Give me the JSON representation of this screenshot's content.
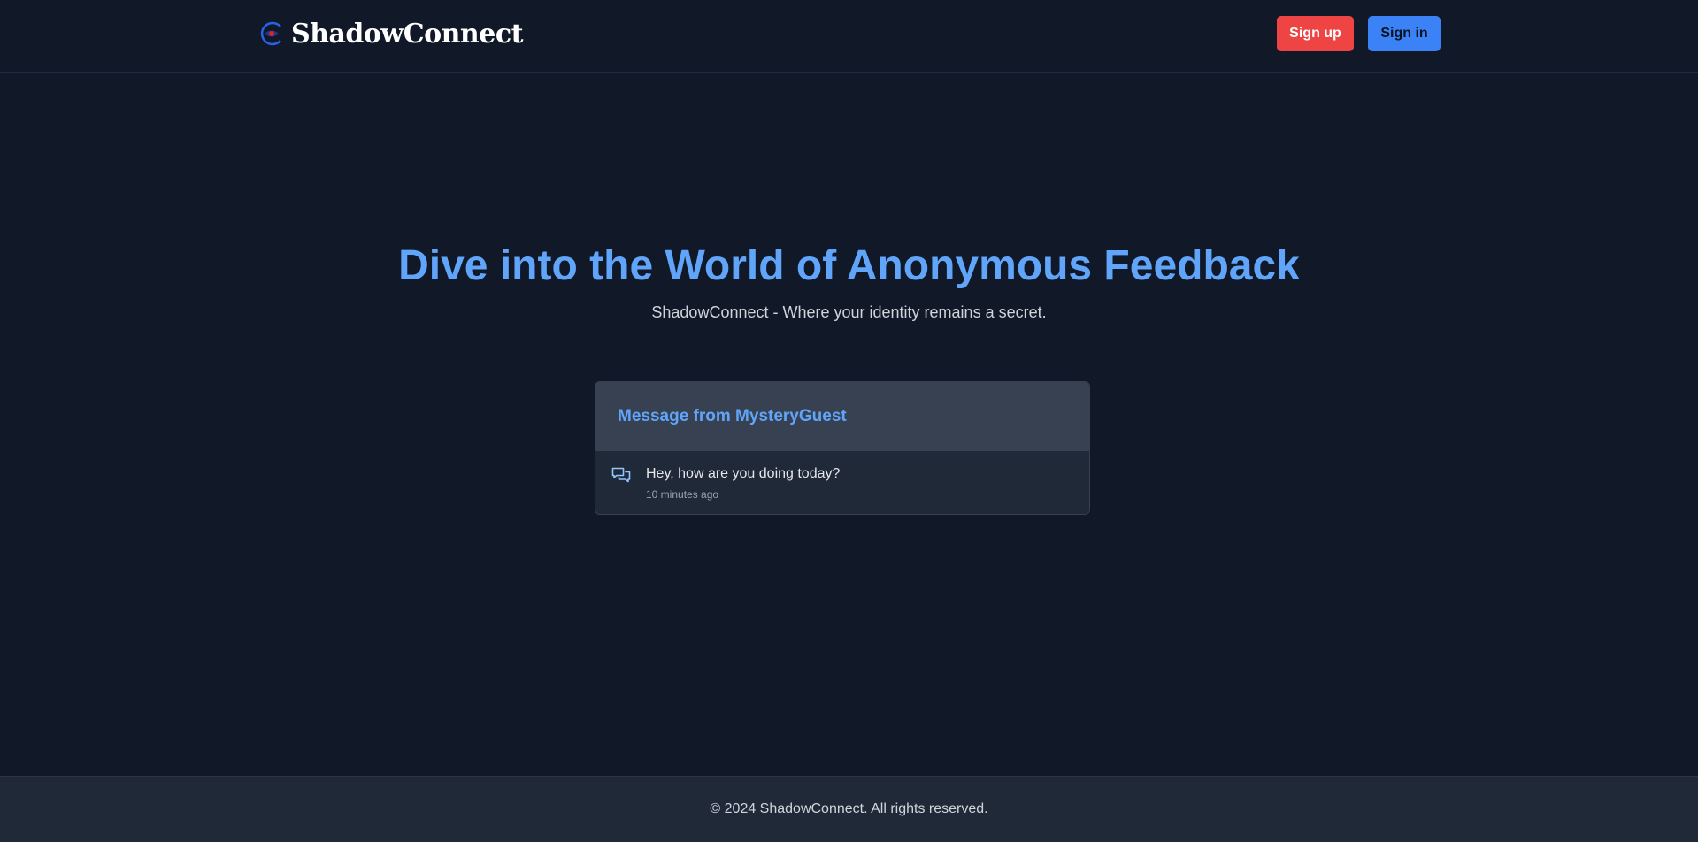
{
  "header": {
    "brand_name": "ShadowConnect",
    "logo_icon": "eye-logo-icon",
    "signup_label": "Sign up",
    "signin_label": "Sign in"
  },
  "hero": {
    "title": "Dive into the World of Anonymous Feedback",
    "subtitle": "ShadowConnect - Where your identity remains a secret."
  },
  "message_card": {
    "title": "Message from MysteryGuest",
    "icon": "chat-bubbles-icon",
    "message": "Hey, how are you doing today?",
    "time": "10 minutes ago"
  },
  "footer": {
    "text": "© 2024 ShadowConnect. All rights reserved."
  },
  "colors": {
    "background": "#111827",
    "accent_blue": "#60a5fa",
    "signup_red": "#ef4444",
    "signin_blue": "#3b82f6",
    "card_header": "#374151",
    "card_body": "#1f2937"
  }
}
